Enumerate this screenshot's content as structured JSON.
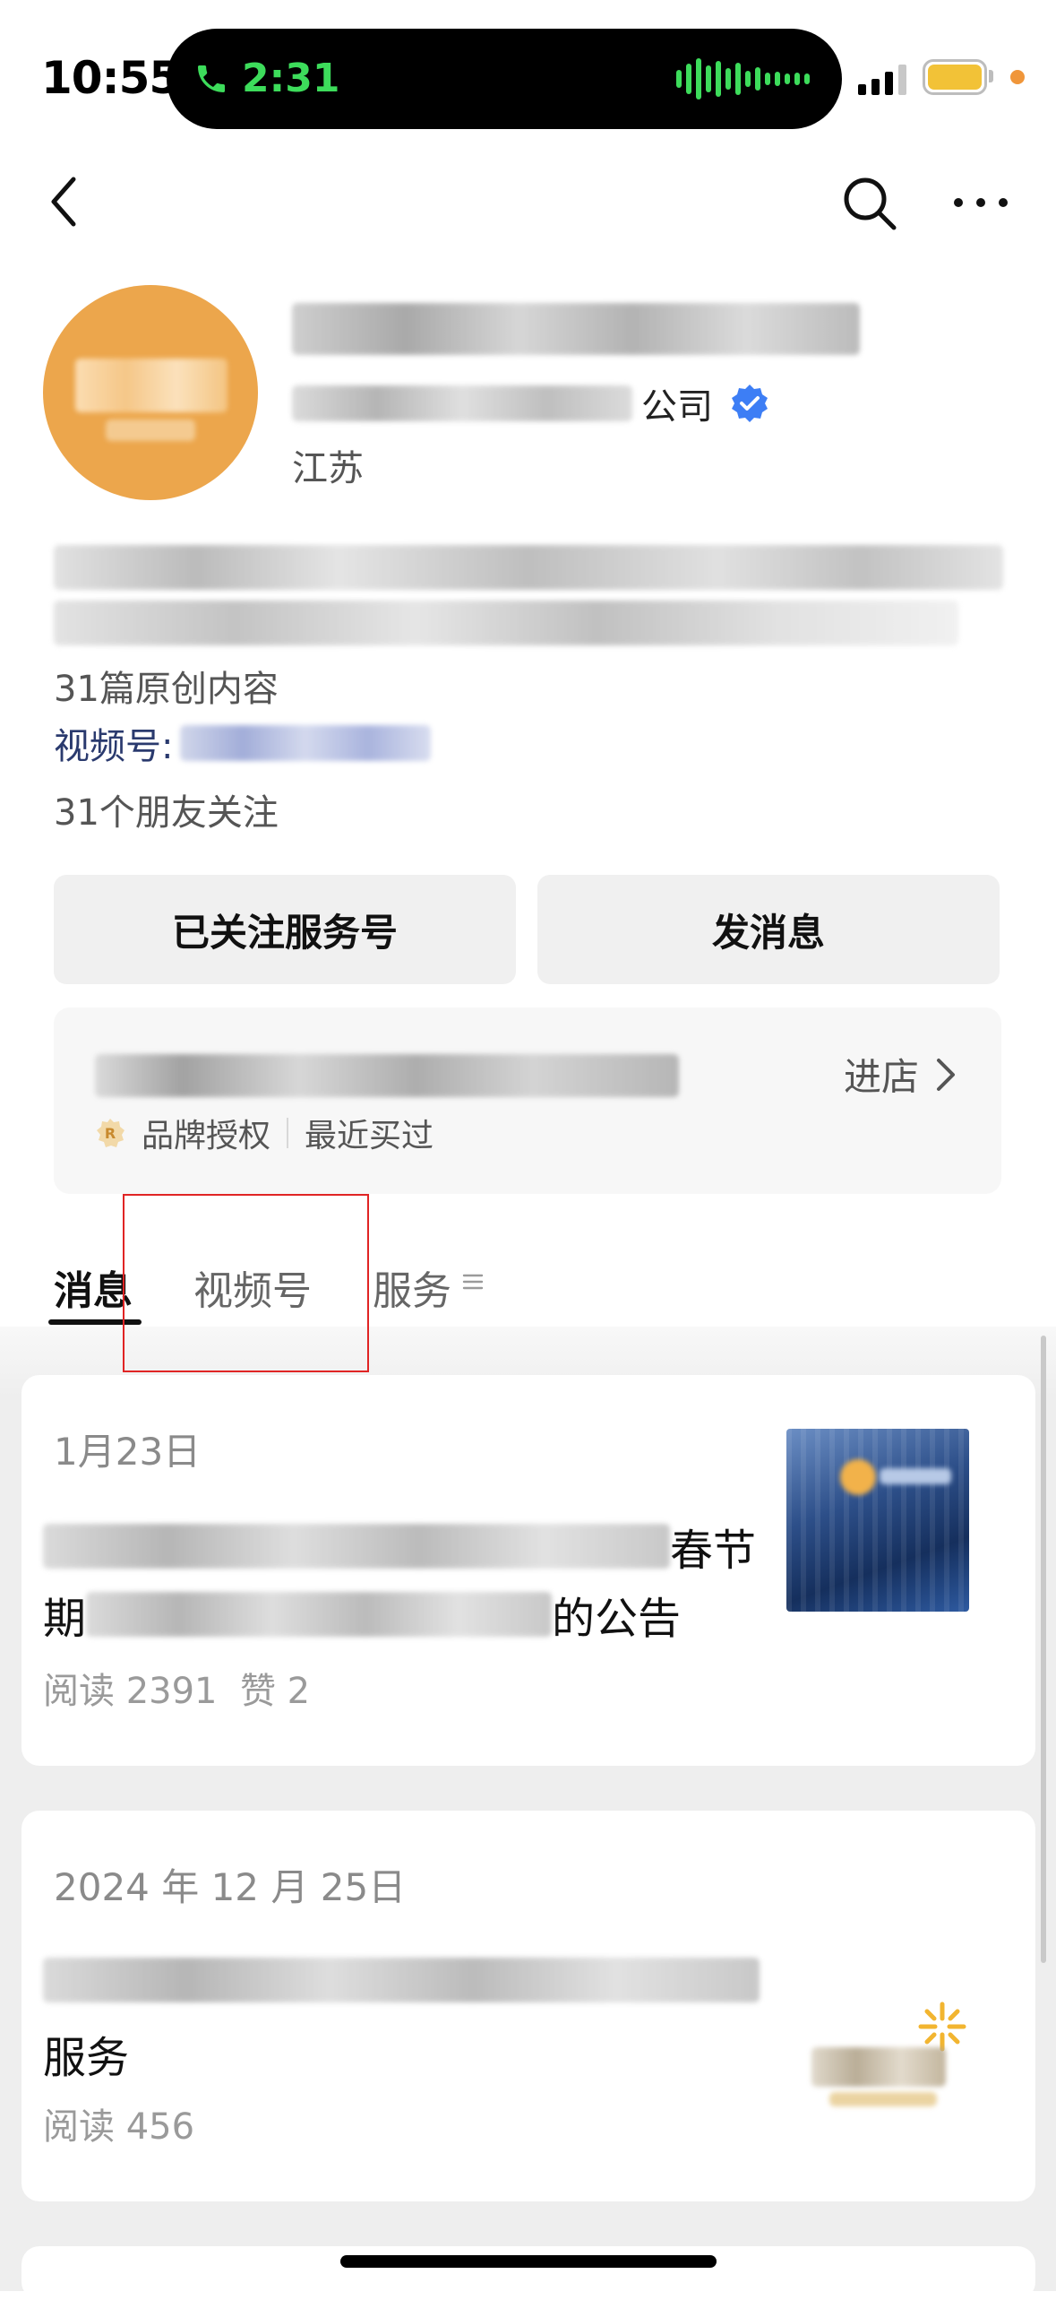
{
  "status_bar": {
    "time": "10:55",
    "call_duration": "2:31",
    "call_color": "#3ddc5b",
    "battery_color": "#f2c237"
  },
  "nav": {
    "back_icon": "chevron-left-icon",
    "search_icon": "search-icon",
    "more_icon": "more-dots-icon"
  },
  "profile": {
    "subtitle_suffix": "公司",
    "region": "江苏",
    "original_count": "31篇原创内容",
    "video_channel_label": "视频号:",
    "friends_following": "31个朋友关注"
  },
  "actions": {
    "followed_label": "已关注服务号",
    "message_label": "发消息"
  },
  "store": {
    "enter_label": "进店",
    "brand_auth": "品牌授权",
    "recently_bought": "最近买过"
  },
  "tabs": [
    {
      "label": "消息",
      "active": true
    },
    {
      "label": "视频号",
      "active": false
    },
    {
      "label": "服务",
      "active": false
    }
  ],
  "articles": [
    {
      "date": "1月23日",
      "title_line1_tail": "春节",
      "title_line2_head": "期",
      "title_line2_tail": "的公告",
      "reads": "阅读 2391",
      "likes": "赞 2"
    },
    {
      "date": "2024 年 12 月 25日",
      "title_line2": "服务",
      "reads": "阅读 456"
    }
  ]
}
